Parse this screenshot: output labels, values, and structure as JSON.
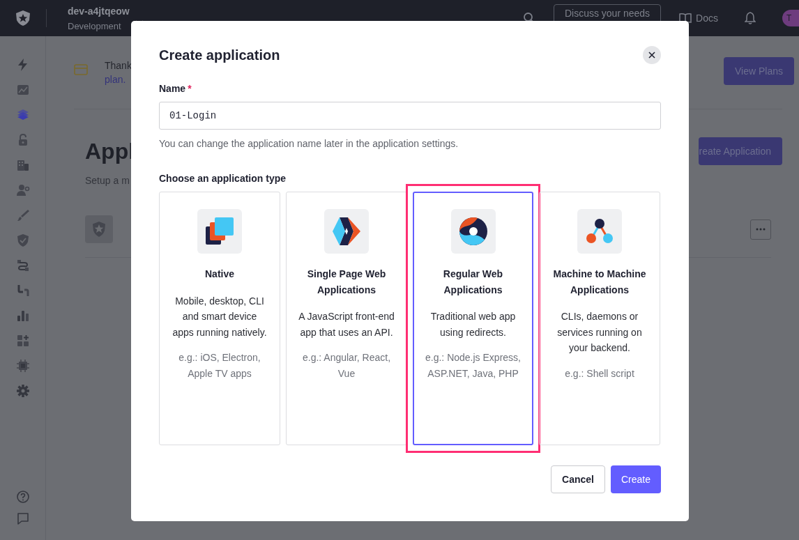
{
  "topbar": {
    "tenant": "dev-a4jtqeow",
    "environment": "Development",
    "discuss_button": "Discuss your needs",
    "docs_link": "Docs",
    "avatar_initial": "T"
  },
  "sidebar": {
    "items": [
      {
        "kind": "bolt",
        "selected": false
      },
      {
        "kind": "chart",
        "selected": false
      },
      {
        "kind": "layers",
        "selected": true
      },
      {
        "kind": "lock",
        "selected": false
      },
      {
        "kind": "building",
        "selected": false
      },
      {
        "kind": "user-gear",
        "selected": false
      },
      {
        "kind": "brush",
        "selected": false
      },
      {
        "kind": "shield",
        "selected": false
      },
      {
        "kind": "flow",
        "selected": false
      },
      {
        "kind": "pipe",
        "selected": false
      },
      {
        "kind": "bars",
        "selected": false
      },
      {
        "kind": "grid-plus",
        "selected": false
      },
      {
        "kind": "chip",
        "selected": false
      },
      {
        "kind": "gear",
        "selected": false
      }
    ],
    "bottom_items": [
      {
        "kind": "help"
      },
      {
        "kind": "chat"
      }
    ]
  },
  "banner": {
    "text": "Thank",
    "link": "plan.",
    "button": "View Plans"
  },
  "page": {
    "title": "Appl",
    "subtitle": "Setup a m",
    "create_button": "reate Application"
  },
  "dialog": {
    "title": "Create application",
    "name_label": "Name",
    "required_mark": "*",
    "name_value": "01-Login",
    "name_hint": "You can change the application name later in the application settings.",
    "type_label": "Choose an application type",
    "types": [
      {
        "kind": "native",
        "title": "Native",
        "description": "Mobile, desktop, CLI and smart device apps running natively.",
        "examples": "e.g.: iOS, Electron, Apple TV apps",
        "selected": false,
        "highlighted": false
      },
      {
        "kind": "spa",
        "title": "Single Page Web Applications",
        "description": "A JavaScript front-end app that uses an API.",
        "examples": "e.g.: Angular, React, Vue",
        "selected": false,
        "highlighted": false
      },
      {
        "kind": "regular",
        "title": "Regular Web Applications",
        "description": "Traditional web app using redirects.",
        "examples": "e.g.: Node.js Express, ASP.NET, Java, PHP",
        "selected": true,
        "highlighted": true
      },
      {
        "kind": "m2m",
        "title": "Machine to Machine Applications",
        "description": "CLIs, daemons or services running on your backend.",
        "examples": "e.g.: Shell script",
        "selected": false,
        "highlighted": false
      }
    ],
    "buttons": [
      {
        "kind": "secondary",
        "label": "Cancel"
      },
      {
        "kind": "primary",
        "label": "Create"
      }
    ]
  }
}
